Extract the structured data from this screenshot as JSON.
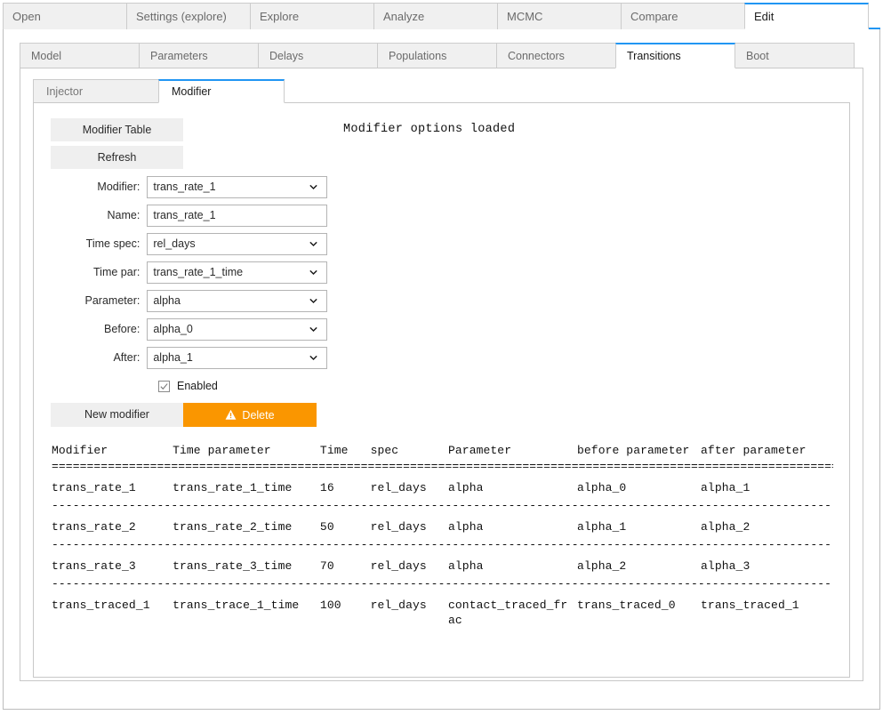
{
  "top_tabs": [
    {
      "label": "Open",
      "active": false
    },
    {
      "label": "Settings (explore)",
      "active": false
    },
    {
      "label": "Explore",
      "active": false
    },
    {
      "label": "Analyze",
      "active": false
    },
    {
      "label": "MCMC",
      "active": false
    },
    {
      "label": "Compare",
      "active": false
    },
    {
      "label": "Edit",
      "active": true
    }
  ],
  "sub_tabs": [
    {
      "label": "Model",
      "active": false
    },
    {
      "label": "Parameters",
      "active": false
    },
    {
      "label": "Delays",
      "active": false
    },
    {
      "label": "Populations",
      "active": false
    },
    {
      "label": "Connectors",
      "active": false
    },
    {
      "label": "Transitions",
      "active": true
    },
    {
      "label": "Boot",
      "active": false
    }
  ],
  "subsub_tabs": [
    {
      "label": "Injector",
      "active": false
    },
    {
      "label": "Modifier",
      "active": true
    }
  ],
  "status_message": "Modifier options loaded",
  "buttons": {
    "modifier_table": "Modifier Table",
    "refresh": "Refresh",
    "new_modifier": "New modifier",
    "delete": "Delete",
    "delete_icon": "warning-triangle-icon"
  },
  "form": {
    "modifier": {
      "label": "Modifier:",
      "value": "trans_rate_1",
      "type": "select"
    },
    "name": {
      "label": "Name:",
      "value": "trans_rate_1",
      "type": "text"
    },
    "time_spec": {
      "label": "Time spec:",
      "value": "rel_days",
      "type": "select"
    },
    "time_par": {
      "label": "Time par:",
      "value": "trans_rate_1_time",
      "type": "select"
    },
    "parameter": {
      "label": "Parameter:",
      "value": "alpha",
      "type": "select"
    },
    "before": {
      "label": "Before:",
      "value": "alpha_0",
      "type": "select"
    },
    "after": {
      "label": "After:",
      "value": "alpha_1",
      "type": "select"
    },
    "enabled": {
      "label": "Enabled",
      "checked": true
    }
  },
  "table": {
    "columns": [
      "Modifier",
      "Time parameter",
      "Time",
      "spec",
      "Parameter",
      "before parameter",
      "after parameter"
    ],
    "header_separator": "===========================================================================================================================================",
    "row_separator": "-------------------------------------------------------------------------------------------------------------------------------------------",
    "rows": [
      {
        "modifier": "trans_rate_1",
        "time_parameter": "trans_rate_1_time",
        "time": "16",
        "spec": "rel_days",
        "parameter": "alpha",
        "before_parameter": "alpha_0",
        "after_parameter": "alpha_1"
      },
      {
        "modifier": "trans_rate_2",
        "time_parameter": "trans_rate_2_time",
        "time": "50",
        "spec": "rel_days",
        "parameter": "alpha",
        "before_parameter": "alpha_1",
        "after_parameter": "alpha_2"
      },
      {
        "modifier": "trans_rate_3",
        "time_parameter": "trans_rate_3_time",
        "time": "70",
        "spec": "rel_days",
        "parameter": "alpha",
        "before_parameter": "alpha_2",
        "after_parameter": "alpha_3"
      },
      {
        "modifier": "trans_traced_1",
        "time_parameter": "trans_trace_1_time",
        "time": "100",
        "spec": "rel_days",
        "parameter": "contact_traced_frac",
        "before_parameter": "trans_traced_0",
        "after_parameter": "trans_traced_1"
      }
    ]
  },
  "colors": {
    "accent_blue": "#2196f3",
    "delete_orange": "#fa9600",
    "tab_inactive_bg": "#f0f0f0",
    "button_bg": "#efefef"
  }
}
